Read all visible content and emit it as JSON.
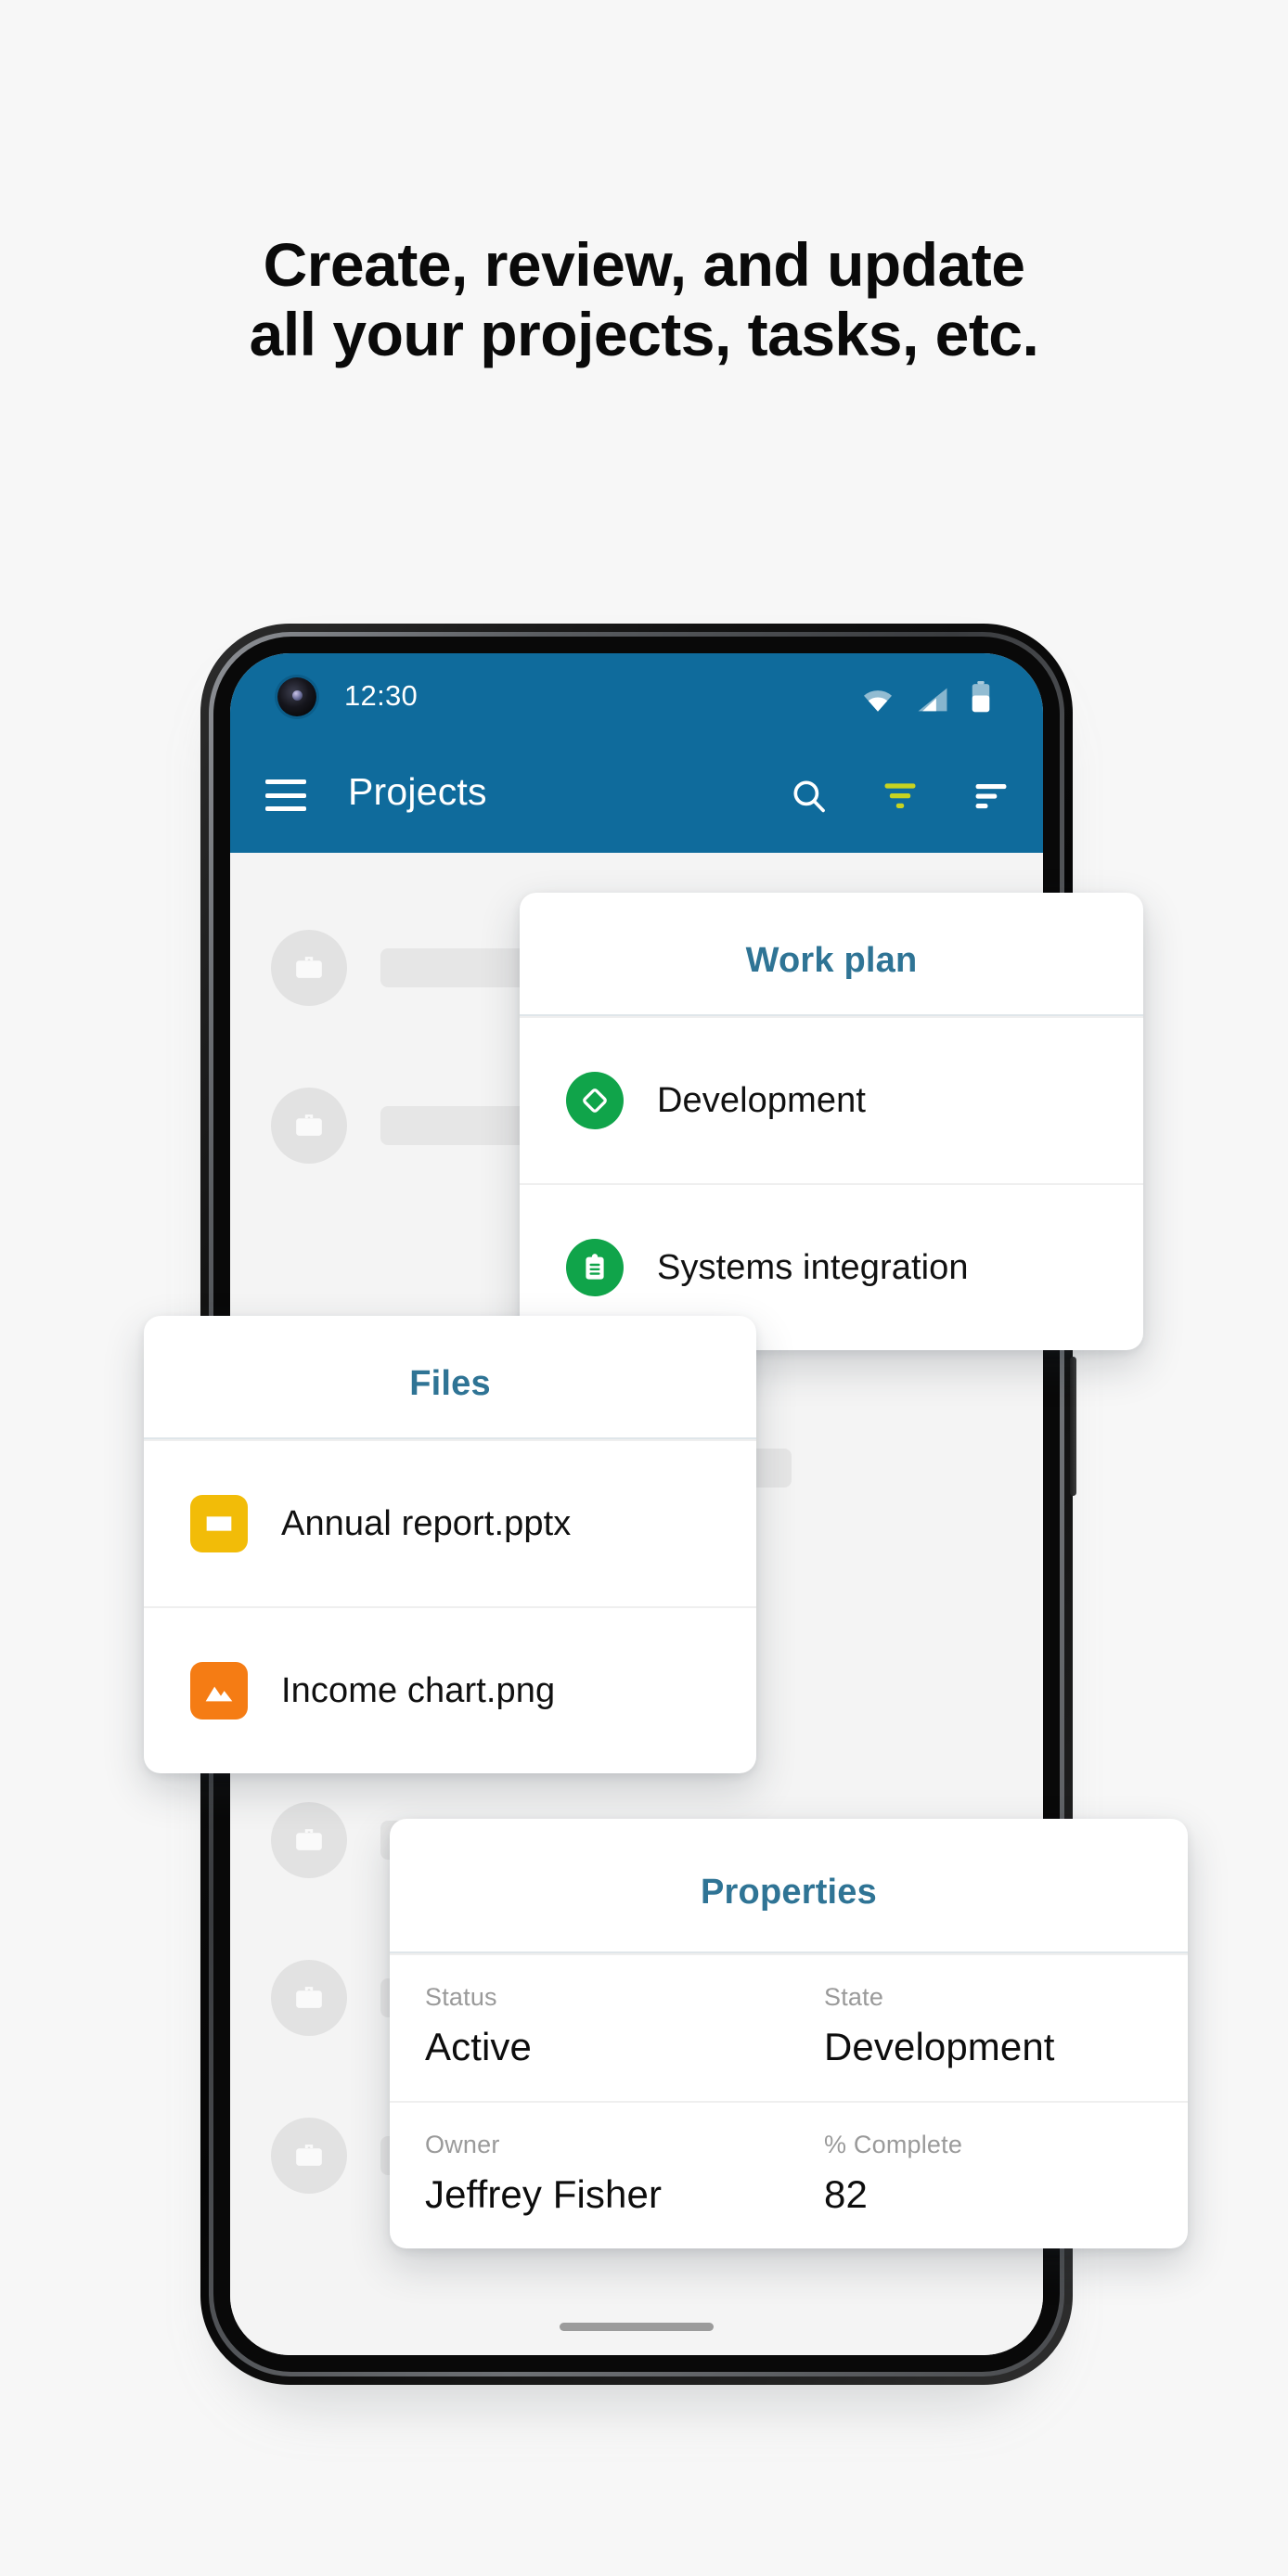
{
  "headline": {
    "line1": "Create, review, and update",
    "line2": "all your projects, tasks, etc."
  },
  "colors": {
    "page_background": "#f7f7f7",
    "appbar_blue": "#0f6b9c",
    "card_title_teal": "#2f7495",
    "filter_active_yellow": "#c7d321",
    "green_badge": "#10a44a",
    "pptx_yellow": "#f2bc08",
    "png_orange": "#f57c14"
  },
  "phone": {
    "status_bar": {
      "time": "12:30",
      "icons": [
        "wifi-icon",
        "cellular-signal-icon",
        "battery-icon"
      ],
      "camera": "front-camera-punch-hole"
    },
    "app_bar": {
      "menu_icon": "hamburger-menu-icon",
      "title": "Projects",
      "actions": [
        {
          "name": "search-icon",
          "label": "Search",
          "active": false
        },
        {
          "name": "filter-icon",
          "label": "Filter",
          "active": true
        },
        {
          "name": "sort-icon",
          "label": "Sort",
          "active": false
        }
      ]
    },
    "skeleton_rows": 5,
    "skeleton_icon": "briefcase-icon",
    "home_indicator": "home-gesture-bar"
  },
  "cards": {
    "work_plan": {
      "title": "Work plan",
      "items": [
        {
          "label": "Development",
          "icon": "diamond-icon"
        },
        {
          "label": "Systems integration",
          "icon": "clipboard-icon"
        }
      ]
    },
    "files": {
      "title": "Files",
      "items": [
        {
          "label": "Annual report.pptx",
          "icon": "presentation-file-icon"
        },
        {
          "label": "Income chart.png",
          "icon": "image-file-icon"
        }
      ]
    },
    "properties": {
      "title": "Properties",
      "fields": [
        {
          "key": "Status",
          "value": "Active"
        },
        {
          "key": "State",
          "value": "Development"
        },
        {
          "key": "Owner",
          "value": "Jeffrey Fisher"
        },
        {
          "key": "% Complete",
          "value": "82"
        }
      ]
    }
  }
}
